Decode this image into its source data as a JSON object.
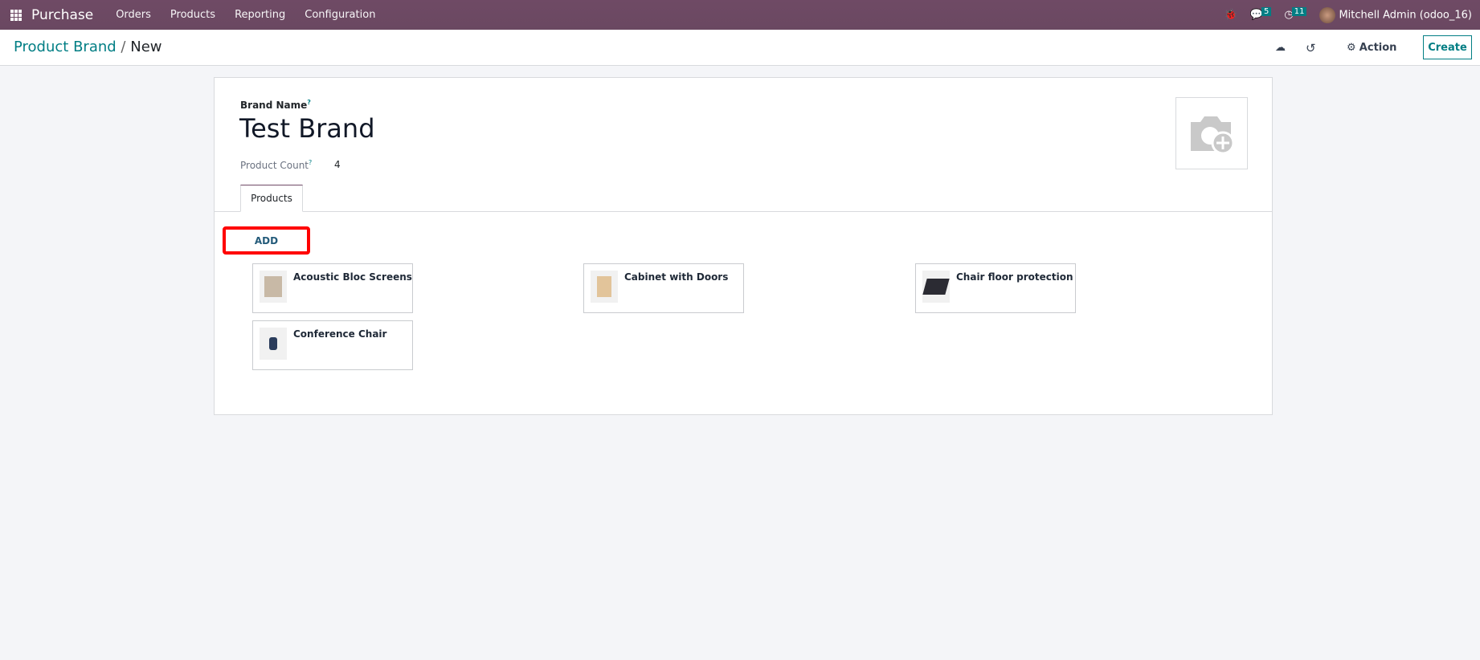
{
  "navbar": {
    "app": "Purchase",
    "menu": [
      "Orders",
      "Products",
      "Reporting",
      "Configuration"
    ],
    "messages_count": "5",
    "activities_count": "11",
    "user": "Mitchell Admin (odoo_16)"
  },
  "control_panel": {
    "breadcrumb_parent": "Product Brand",
    "breadcrumb_current": "New",
    "action_label": "Action",
    "create_label": "Create"
  },
  "form": {
    "brand_name_label": "Brand Name",
    "help_mark": "?",
    "brand_name": "Test Brand",
    "product_count_label": "Product Count",
    "product_count": "4",
    "tab_products": "Products",
    "add_label": "ADD",
    "products": [
      {
        "name": "Acoustic Bloc Screens",
        "color": "#c8b9a6"
      },
      {
        "name": "Cabinet with Doors",
        "color": "#e2c49a"
      },
      {
        "name": "Chair floor protection",
        "color": "#2b2b33"
      },
      {
        "name": "Conference Chair",
        "color": "#2b3d5c"
      }
    ]
  },
  "colors": {
    "navbar": "#714b67",
    "accent": "#017e84",
    "highlight": "#ff0000"
  }
}
